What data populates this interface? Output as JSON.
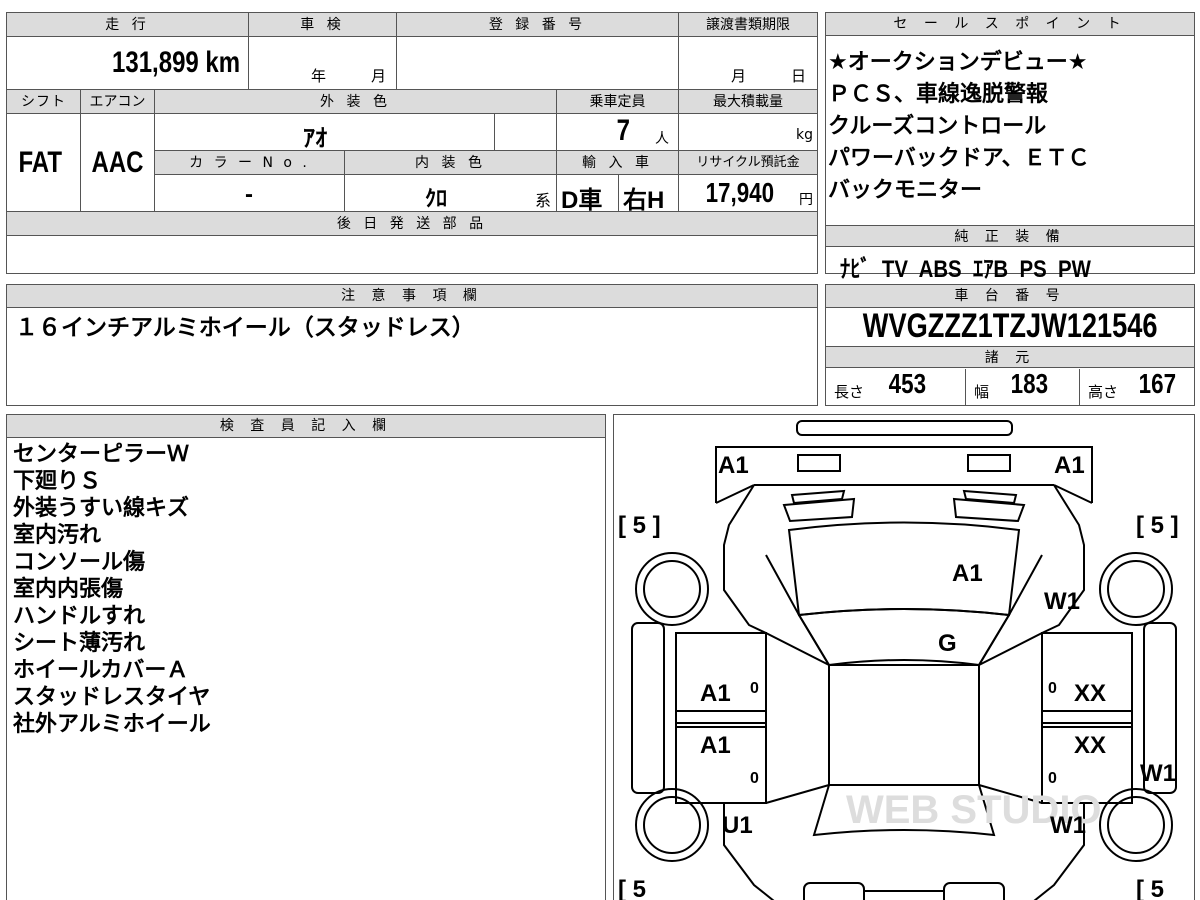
{
  "left_top": {
    "mileage_header": "走 行",
    "mileage_value": "131,899 km",
    "inspection_header": "車 検",
    "inspection_year": "年",
    "inspection_month": "月",
    "registration_header": "登 録 番 号",
    "transfer_header": "譲渡書類期限",
    "transfer_month": "月",
    "transfer_day": "日",
    "shift_header": "シフト",
    "aircon_header": "エアコン",
    "exterior_header": "外 装 色",
    "capacity_header": "乗車定員",
    "maxload_header": "最大積載量",
    "shift_value": "FAT",
    "aircon_value": "AAC",
    "exterior_value": "ｱｵ",
    "capacity_value": "7",
    "capacity_unit": "人",
    "maxload_unit": "kg",
    "colorno_header": "カ ラ ー N o .",
    "interior_header": "内 装 色",
    "import_header": "輸 入 車",
    "recycle_header": "リサイクル預託金",
    "colorno_value": "-",
    "interior_value": "ｸﾛ",
    "interior_suffix": "系",
    "import_value": "D車",
    "steering_value": "右H",
    "recycle_value": "17,940",
    "recycle_unit": "円",
    "later_parts_header": "後 日 発 送 部 品"
  },
  "sales_points": {
    "header": "セ ー ル ス ポ イ ン ト",
    "lines": [
      "★オークションデビュー★",
      "ＰＣＳ、車線逸脱警報",
      "クルーズコントロール",
      "パワーバックドア、ＥＴＣ",
      "バックモニター"
    ]
  },
  "equipment": {
    "header": "純 正 装 備",
    "value": "ﾅﾋﾞ  TV  ABS  ｴｱB  PS  PW"
  },
  "notes": {
    "header": "注 意 事 項 欄",
    "value": "１６インチアルミホイール（スタッドレス）"
  },
  "chassis": {
    "header": "車 台 番 号",
    "value": "WVGZZZ1TZJW121546",
    "spec_header": "諸 元",
    "length_label": "長さ",
    "length_value": "453",
    "width_label": "幅",
    "width_value": "183",
    "height_label": "高さ",
    "height_value": "167"
  },
  "inspector": {
    "header": "検 査 員 記 入 欄",
    "lines": [
      "センターピラーＷ",
      "下廻りＳ",
      "外装うすい線キズ",
      "室内汚れ",
      "コンソール傷",
      "室内内張傷",
      "ハンドルすれ",
      "シート薄汚れ",
      "ホイールカバーＡ",
      "スタッドレスタイヤ",
      "社外アルミホイール"
    ]
  },
  "diagram": {
    "marks": {
      "front_left": "A1",
      "front_right": "A1",
      "hood": "A1",
      "windshield": "G",
      "right_fender": "W1",
      "left_front_door": "A1",
      "left_rear_door": "A1",
      "right_front_door": "XX",
      "right_rear_door": "XX",
      "left_rear_quarter": "U1",
      "right_rear_quarter": "W1",
      "right_rear_side": "W1",
      "tire_fl": "[ 5 ]",
      "tire_fr": "[ 5 ]",
      "tire_rl": "[ 5",
      "tire_rr": "[ 5",
      "zero": "0"
    },
    "watermark": "WEB STUDIO"
  }
}
